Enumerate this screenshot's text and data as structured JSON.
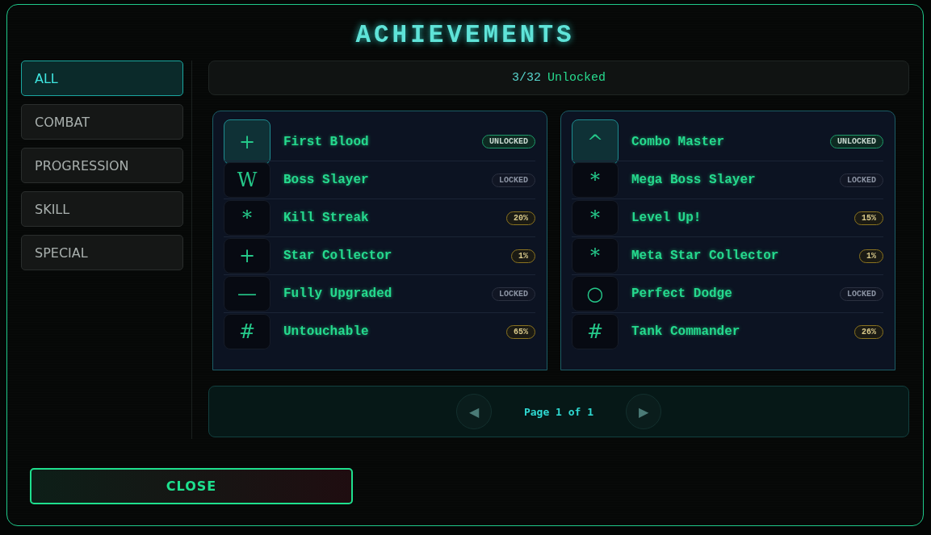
{
  "title": "ACHIEVEMENTS",
  "categories": [
    {
      "label": "ALL",
      "selected": true
    },
    {
      "label": "COMBAT",
      "selected": false
    },
    {
      "label": "PROGRESSION",
      "selected": false
    },
    {
      "label": "SKILL",
      "selected": false
    },
    {
      "label": "SPECIAL",
      "selected": false
    }
  ],
  "counter": {
    "count": "3/32",
    "label": "Unlocked"
  },
  "columns": [
    [
      {
        "icon": "+",
        "name": "First Blood",
        "kind": "unlocked",
        "badge": "UNLOCKED",
        "selected": true
      },
      {
        "icon": "W",
        "name": "Boss Slayer",
        "kind": "locked",
        "badge": "LOCKED",
        "selected": false
      },
      {
        "icon": "*",
        "name": "Kill Streak",
        "kind": "progress",
        "badge": "20%",
        "selected": false
      },
      {
        "icon": "+",
        "name": "Star Collector",
        "kind": "progress",
        "badge": "1%",
        "selected": false
      },
      {
        "icon": "—",
        "name": "Fully Upgraded",
        "kind": "locked",
        "badge": "LOCKED",
        "selected": false
      },
      {
        "icon": "#",
        "name": "Untouchable",
        "kind": "progress",
        "badge": "65%",
        "selected": false
      }
    ],
    [
      {
        "icon": "^",
        "name": "Combo Master",
        "kind": "unlocked",
        "badge": "UNLOCKED",
        "selected": true
      },
      {
        "icon": "*",
        "name": "Mega Boss Slayer",
        "kind": "locked",
        "badge": "LOCKED",
        "selected": false
      },
      {
        "icon": "*",
        "name": "Level Up!",
        "kind": "progress",
        "badge": "15%",
        "selected": false
      },
      {
        "icon": "*",
        "name": "Meta Star Collector",
        "kind": "progress",
        "badge": "1%",
        "selected": false
      },
      {
        "icon": "○",
        "name": "Perfect Dodge",
        "kind": "locked",
        "badge": "LOCKED",
        "selected": false
      },
      {
        "icon": "#",
        "name": "Tank Commander",
        "kind": "progress",
        "badge": "26%",
        "selected": false
      }
    ]
  ],
  "pagination": {
    "label": "Page 1 of 1",
    "prev": "◀",
    "next": "▶"
  },
  "close": "CLOSE"
}
